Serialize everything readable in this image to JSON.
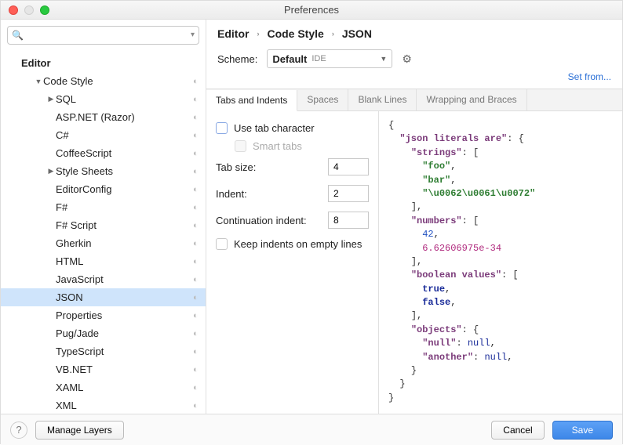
{
  "title": "Preferences",
  "sidebar": {
    "search_placeholder": "",
    "editor_label": "Editor",
    "code_style_label": "Code Style",
    "items": [
      {
        "label": "SQL",
        "expander": "▶"
      },
      {
        "label": "ASP.NET (Razor)"
      },
      {
        "label": "C#"
      },
      {
        "label": "CoffeeScript"
      },
      {
        "label": "Style Sheets",
        "expander": "▶"
      },
      {
        "label": "EditorConfig"
      },
      {
        "label": "F#"
      },
      {
        "label": "F# Script"
      },
      {
        "label": "Gherkin"
      },
      {
        "label": "HTML"
      },
      {
        "label": "JavaScript"
      },
      {
        "label": "JSON",
        "selected": true
      },
      {
        "label": "Properties"
      },
      {
        "label": "Pug/Jade"
      },
      {
        "label": "TypeScript"
      },
      {
        "label": "VB.NET"
      },
      {
        "label": "XAML"
      },
      {
        "label": "XML"
      }
    ]
  },
  "breadcrumb": {
    "a": "Editor",
    "b": "Code Style",
    "c": "JSON"
  },
  "scheme": {
    "label": "Scheme:",
    "value": "Default",
    "ide": "IDE",
    "link": "Set from..."
  },
  "tabs": [
    "Tabs and Indents",
    "Spaces",
    "Blank Lines",
    "Wrapping and Braces"
  ],
  "form": {
    "use_tab": "Use tab character",
    "smart_tabs": "Smart tabs",
    "tab_size": "Tab size:",
    "tab_size_val": "4",
    "indent": "Indent:",
    "indent_val": "2",
    "cont": "Continuation indent:",
    "cont_val": "8",
    "keep": "Keep indents on empty lines"
  },
  "preview": {
    "l0": "{",
    "k1": "\"json literals are\"",
    "v1": ": {",
    "k2": "\"strings\"",
    "v2": ": [",
    "s1": "\"foo\"",
    "c": ",",
    "s2": "\"bar\"",
    "s3": "\"\\u0062\\u0061\\u0072\"",
    "cb": "],",
    "k3": "\"numbers\"",
    "n1": "42",
    "n2": "6.62606975e-34",
    "k4": "\"boolean values\"",
    "b1": "true",
    "b2": "false",
    "k5": "\"objects\"",
    "v5": ": {",
    "k6": "\"null\"",
    "v6": ": ",
    "nv": "null",
    "k7": "\"another\"",
    "rb": "}",
    "cbrace": "}"
  },
  "footer": {
    "manage": "Manage Layers",
    "cancel": "Cancel",
    "save": "Save"
  }
}
